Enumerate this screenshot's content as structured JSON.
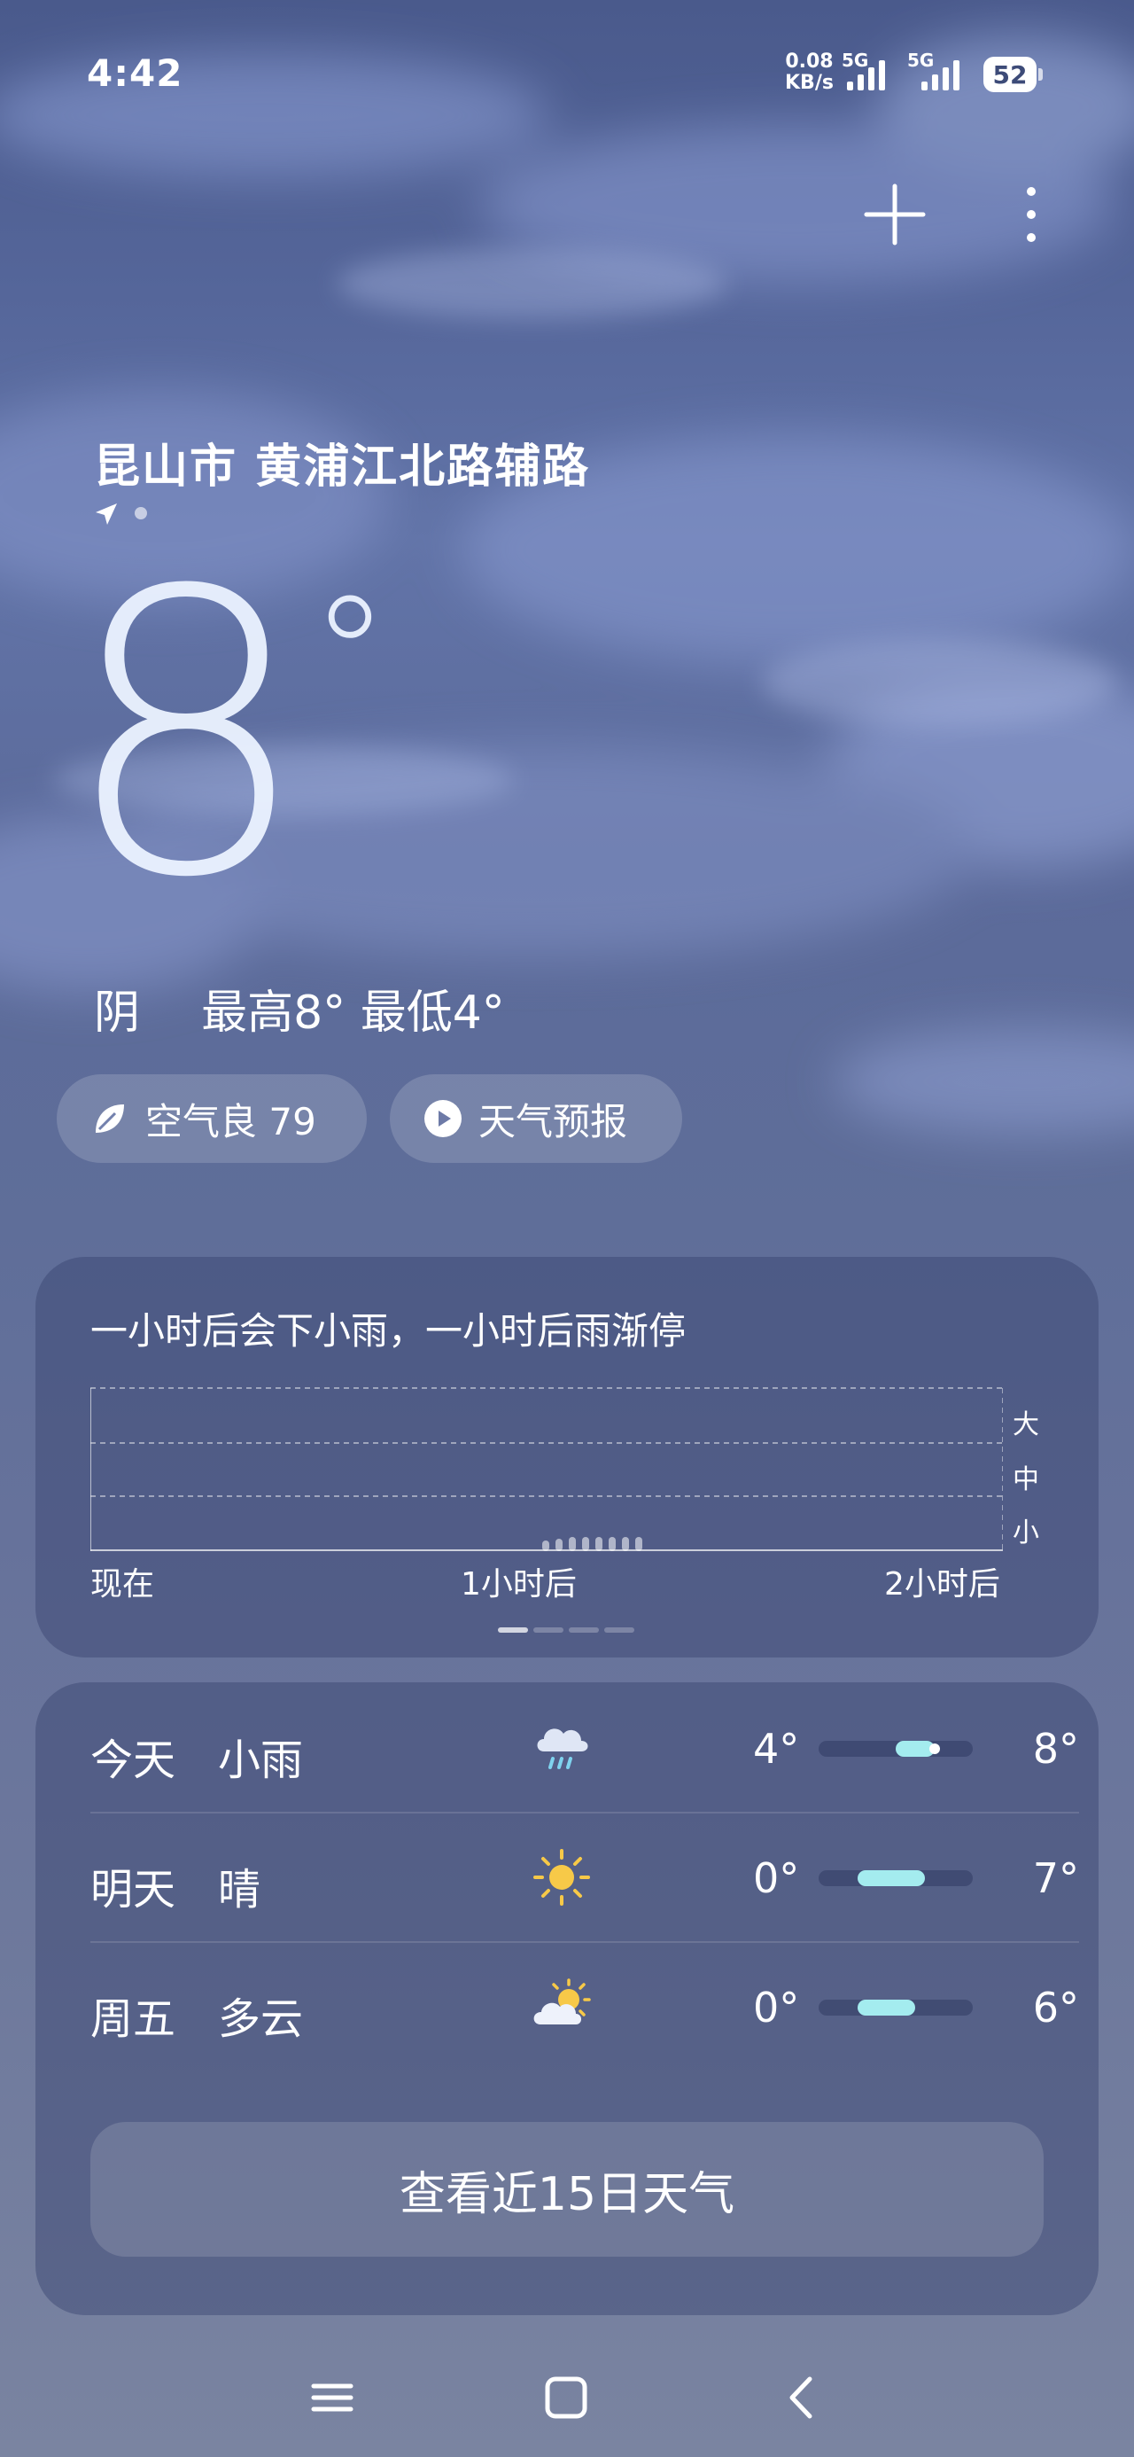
{
  "status_bar": {
    "time": "4:42",
    "net_speed_value": "0.08",
    "net_speed_unit": "KB/s",
    "sim1": "5G",
    "sim2": "5G",
    "battery": "52"
  },
  "header": {
    "location": "昆山市 黄浦江北路辅路"
  },
  "current": {
    "temp": "8",
    "degree": "°",
    "condition": "阴",
    "high_low": "最高8° 最低4°"
  },
  "chips": {
    "aqi": "空气良 79",
    "forecast": "天气预报"
  },
  "rain_card": {
    "title": "一小时后会下小雨，一小时后雨渐停",
    "levels": [
      "大",
      "中",
      "小"
    ],
    "x_labels": [
      "现在",
      "1小时后",
      "2小时后"
    ]
  },
  "daily": [
    {
      "day": "今天",
      "condition": "小雨",
      "icon": "light-rain-icon",
      "low": "4°",
      "high": "8°",
      "low_value": 4,
      "high_value": 8,
      "current_value": 8
    },
    {
      "day": "明天",
      "condition": "晴",
      "icon": "sunny-icon",
      "low": "0°",
      "high": "7°",
      "low_value": 0,
      "high_value": 7
    },
    {
      "day": "周五",
      "condition": "多云",
      "icon": "partly-cloudy-icon",
      "low": "0°",
      "high": "6°",
      "low_value": 0,
      "high_value": 6
    }
  ],
  "range_scale": [
    -4,
    12
  ],
  "button_15day": "查看近15日天气",
  "colors": {
    "range_fill": "#a4ecef",
    "sun": "#f7c948"
  }
}
